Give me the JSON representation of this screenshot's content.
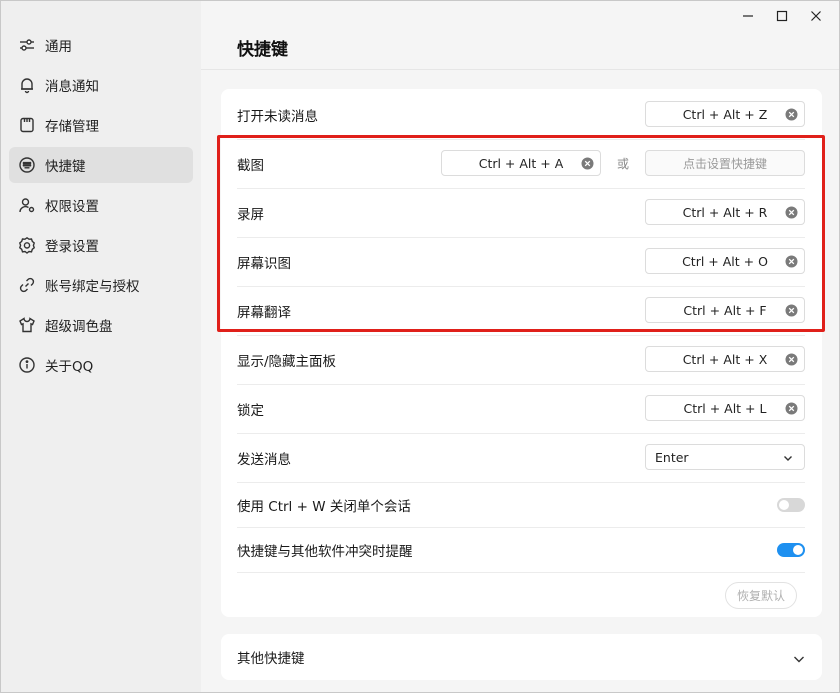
{
  "window": {
    "controls": [
      "minimize-icon",
      "maximize-icon",
      "close-icon"
    ]
  },
  "sidebar": {
    "items": [
      {
        "label": "通用",
        "icon": "sliders-icon",
        "active": false
      },
      {
        "label": "消息通知",
        "icon": "bell-icon",
        "active": false
      },
      {
        "label": "存储管理",
        "icon": "storage-icon",
        "active": false
      },
      {
        "label": "快捷键",
        "icon": "keyboard-icon",
        "active": true
      },
      {
        "label": "权限设置",
        "icon": "user-gear-icon",
        "active": false
      },
      {
        "label": "登录设置",
        "icon": "gear-icon",
        "active": false
      },
      {
        "label": "账号绑定与授权",
        "icon": "link-icon",
        "active": false
      },
      {
        "label": "超级调色盘",
        "icon": "tshirt-icon",
        "active": false
      },
      {
        "label": "关于QQ",
        "icon": "info-icon",
        "active": false
      }
    ]
  },
  "main": {
    "title": "快捷键",
    "shortcuts": [
      {
        "label": "打开未读消息",
        "key": "Ctrl + Alt + Z"
      },
      {
        "label": "截图",
        "key": "Ctrl + Alt + A",
        "or": "或",
        "alt_placeholder": "点击设置快捷键"
      },
      {
        "label": "录屏",
        "key": "Ctrl + Alt + R"
      },
      {
        "label": "屏幕识图",
        "key": "Ctrl + Alt + O"
      },
      {
        "label": "屏幕翻译",
        "key": "Ctrl + Alt + F"
      },
      {
        "label": "显示/隐藏主面板",
        "key": "Ctrl + Alt + X"
      },
      {
        "label": "锁定",
        "key": "Ctrl + Alt + L"
      }
    ],
    "send_message": {
      "label": "发送消息",
      "value": "Enter"
    },
    "toggles": [
      {
        "label": "使用 Ctrl + W 关闭单个会话",
        "on": false
      },
      {
        "label": "快捷键与其他软件冲突时提醒",
        "on": true
      }
    ],
    "restore_label": "恢复默认",
    "other_section": "其他快捷键"
  },
  "colors": {
    "accent": "#1e90f0",
    "highlight": "#e0201a"
  }
}
